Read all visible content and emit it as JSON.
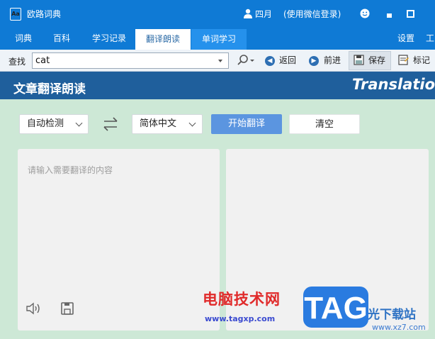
{
  "window": {
    "app_title": "欧路词典",
    "app_icon_text": "Aa",
    "user_name": "四月",
    "login_note": "(使用微信登录)"
  },
  "menu": {
    "items": [
      "词典",
      "百科",
      "学习记录",
      "翻译朗读",
      "单词学习"
    ],
    "active": "翻译朗读",
    "settings": "设置",
    "tools": "工"
  },
  "toolbar": {
    "find_label": "查找",
    "search_value": "cat",
    "back_label": "返回",
    "forward_label": "前进",
    "save_label": "保存",
    "mark_label": "标记"
  },
  "banner": {
    "title": "文章翻译朗读",
    "subtitle_en": "Translation"
  },
  "translator": {
    "source_lang": "自动检测",
    "target_lang": "简体中文",
    "start_label": "开始翻译",
    "clear_label": "清空",
    "input_placeholder": "请输入需要翻译的内容",
    "output_text": ""
  },
  "watermark": {
    "line1": "电脑技术网",
    "line2": "www.tagxp.com",
    "tag": "TAG",
    "line3": "光下载站",
    "line4": "www.xz7.com"
  },
  "colors": {
    "titlebar": "#0f7ad5",
    "banner": "#1f5f9c",
    "content_bg": "#cde8d6",
    "start_button": "#5b95e0"
  }
}
